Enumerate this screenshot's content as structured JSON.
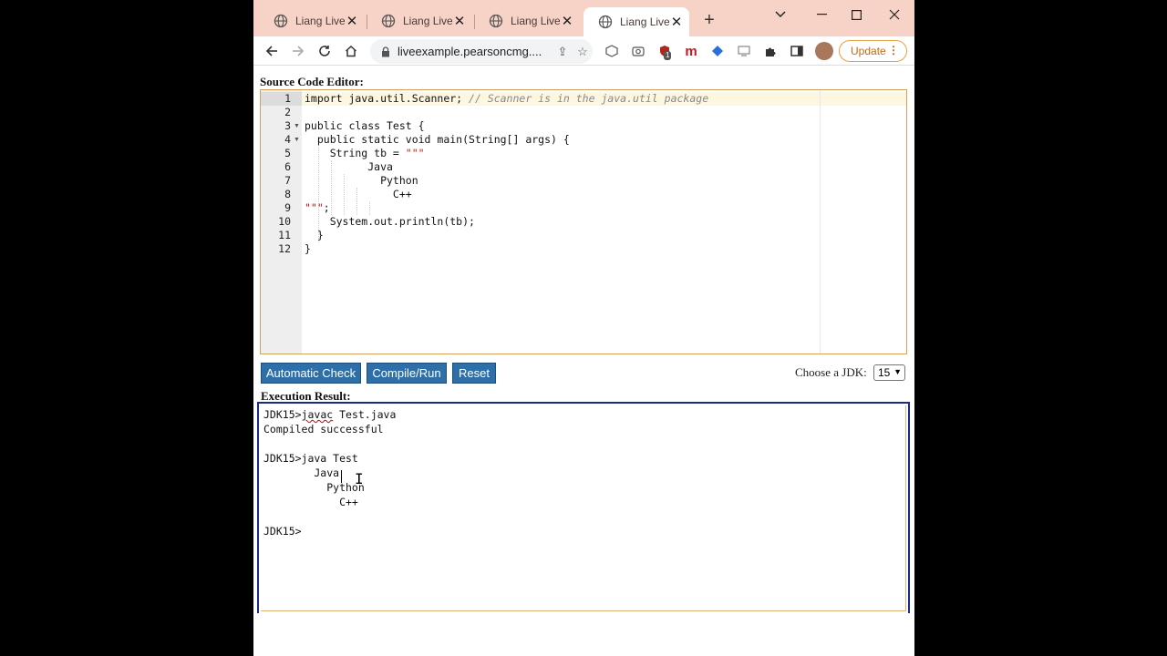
{
  "browser": {
    "tabs": [
      {
        "label": "Liang LiveEx",
        "active": false
      },
      {
        "label": "Liang LiveEx",
        "active": false
      },
      {
        "label": "Liang LiveEx",
        "active": false
      },
      {
        "label": "Liang LiveEx",
        "active": true
      }
    ],
    "new_tab_icon": "plus-icon",
    "url": "liveexample.pearsoncmg....",
    "update_label": "Update",
    "extension_badge": "1",
    "extension_m": "m"
  },
  "page": {
    "editor_heading": "Source Code Editor:",
    "code_lines": [
      {
        "n": "1",
        "fold": false
      },
      {
        "n": "2",
        "fold": false
      },
      {
        "n": "3",
        "fold": true
      },
      {
        "n": "4",
        "fold": true
      },
      {
        "n": "5",
        "fold": false
      },
      {
        "n": "6",
        "fold": false
      },
      {
        "n": "7",
        "fold": false
      },
      {
        "n": "8",
        "fold": false
      },
      {
        "n": "9",
        "fold": false
      },
      {
        "n": "10",
        "fold": false
      },
      {
        "n": "11",
        "fold": false
      },
      {
        "n": "12",
        "fold": false
      }
    ],
    "code": {
      "l1_code": "import java.util.Scanner; ",
      "l1_comment": "// Scanner is in the java.util package",
      "l3": "public class Test {",
      "l4": "  public static void main(String[] args) {",
      "l5_code": "    String tb = ",
      "l5_str": "\"\"\"",
      "l6": "          Java",
      "l7": "            Python",
      "l8": "              C++",
      "l9_str": "\"\"\"",
      "l9_code": ";",
      "l10": "    System.out.println(tb);",
      "l11": "  }",
      "l12": "}"
    },
    "buttons": {
      "check": "Automatic Check",
      "compile": "Compile/Run",
      "reset": "Reset"
    },
    "jdk_label": "Choose a JDK:",
    "jdk_value": "15",
    "result_heading": "Execution Result:",
    "output": {
      "prompt1": "JDK15>",
      "cmd1": "javac",
      "cmd1_rest": " Test.java",
      "line2": "Compiled successful",
      "line4": "JDK15>java Test",
      "line5": "        Java",
      "line6": "          Python",
      "line7": "            C++",
      "line9": "JDK15>"
    }
  },
  "colors": {
    "tab_strip": "#f6d3c6",
    "button_blue": "#2f6fa8",
    "editor_border": "#d4a05a",
    "output_border": "#1a2a8a",
    "string_red": "#c41a16"
  }
}
